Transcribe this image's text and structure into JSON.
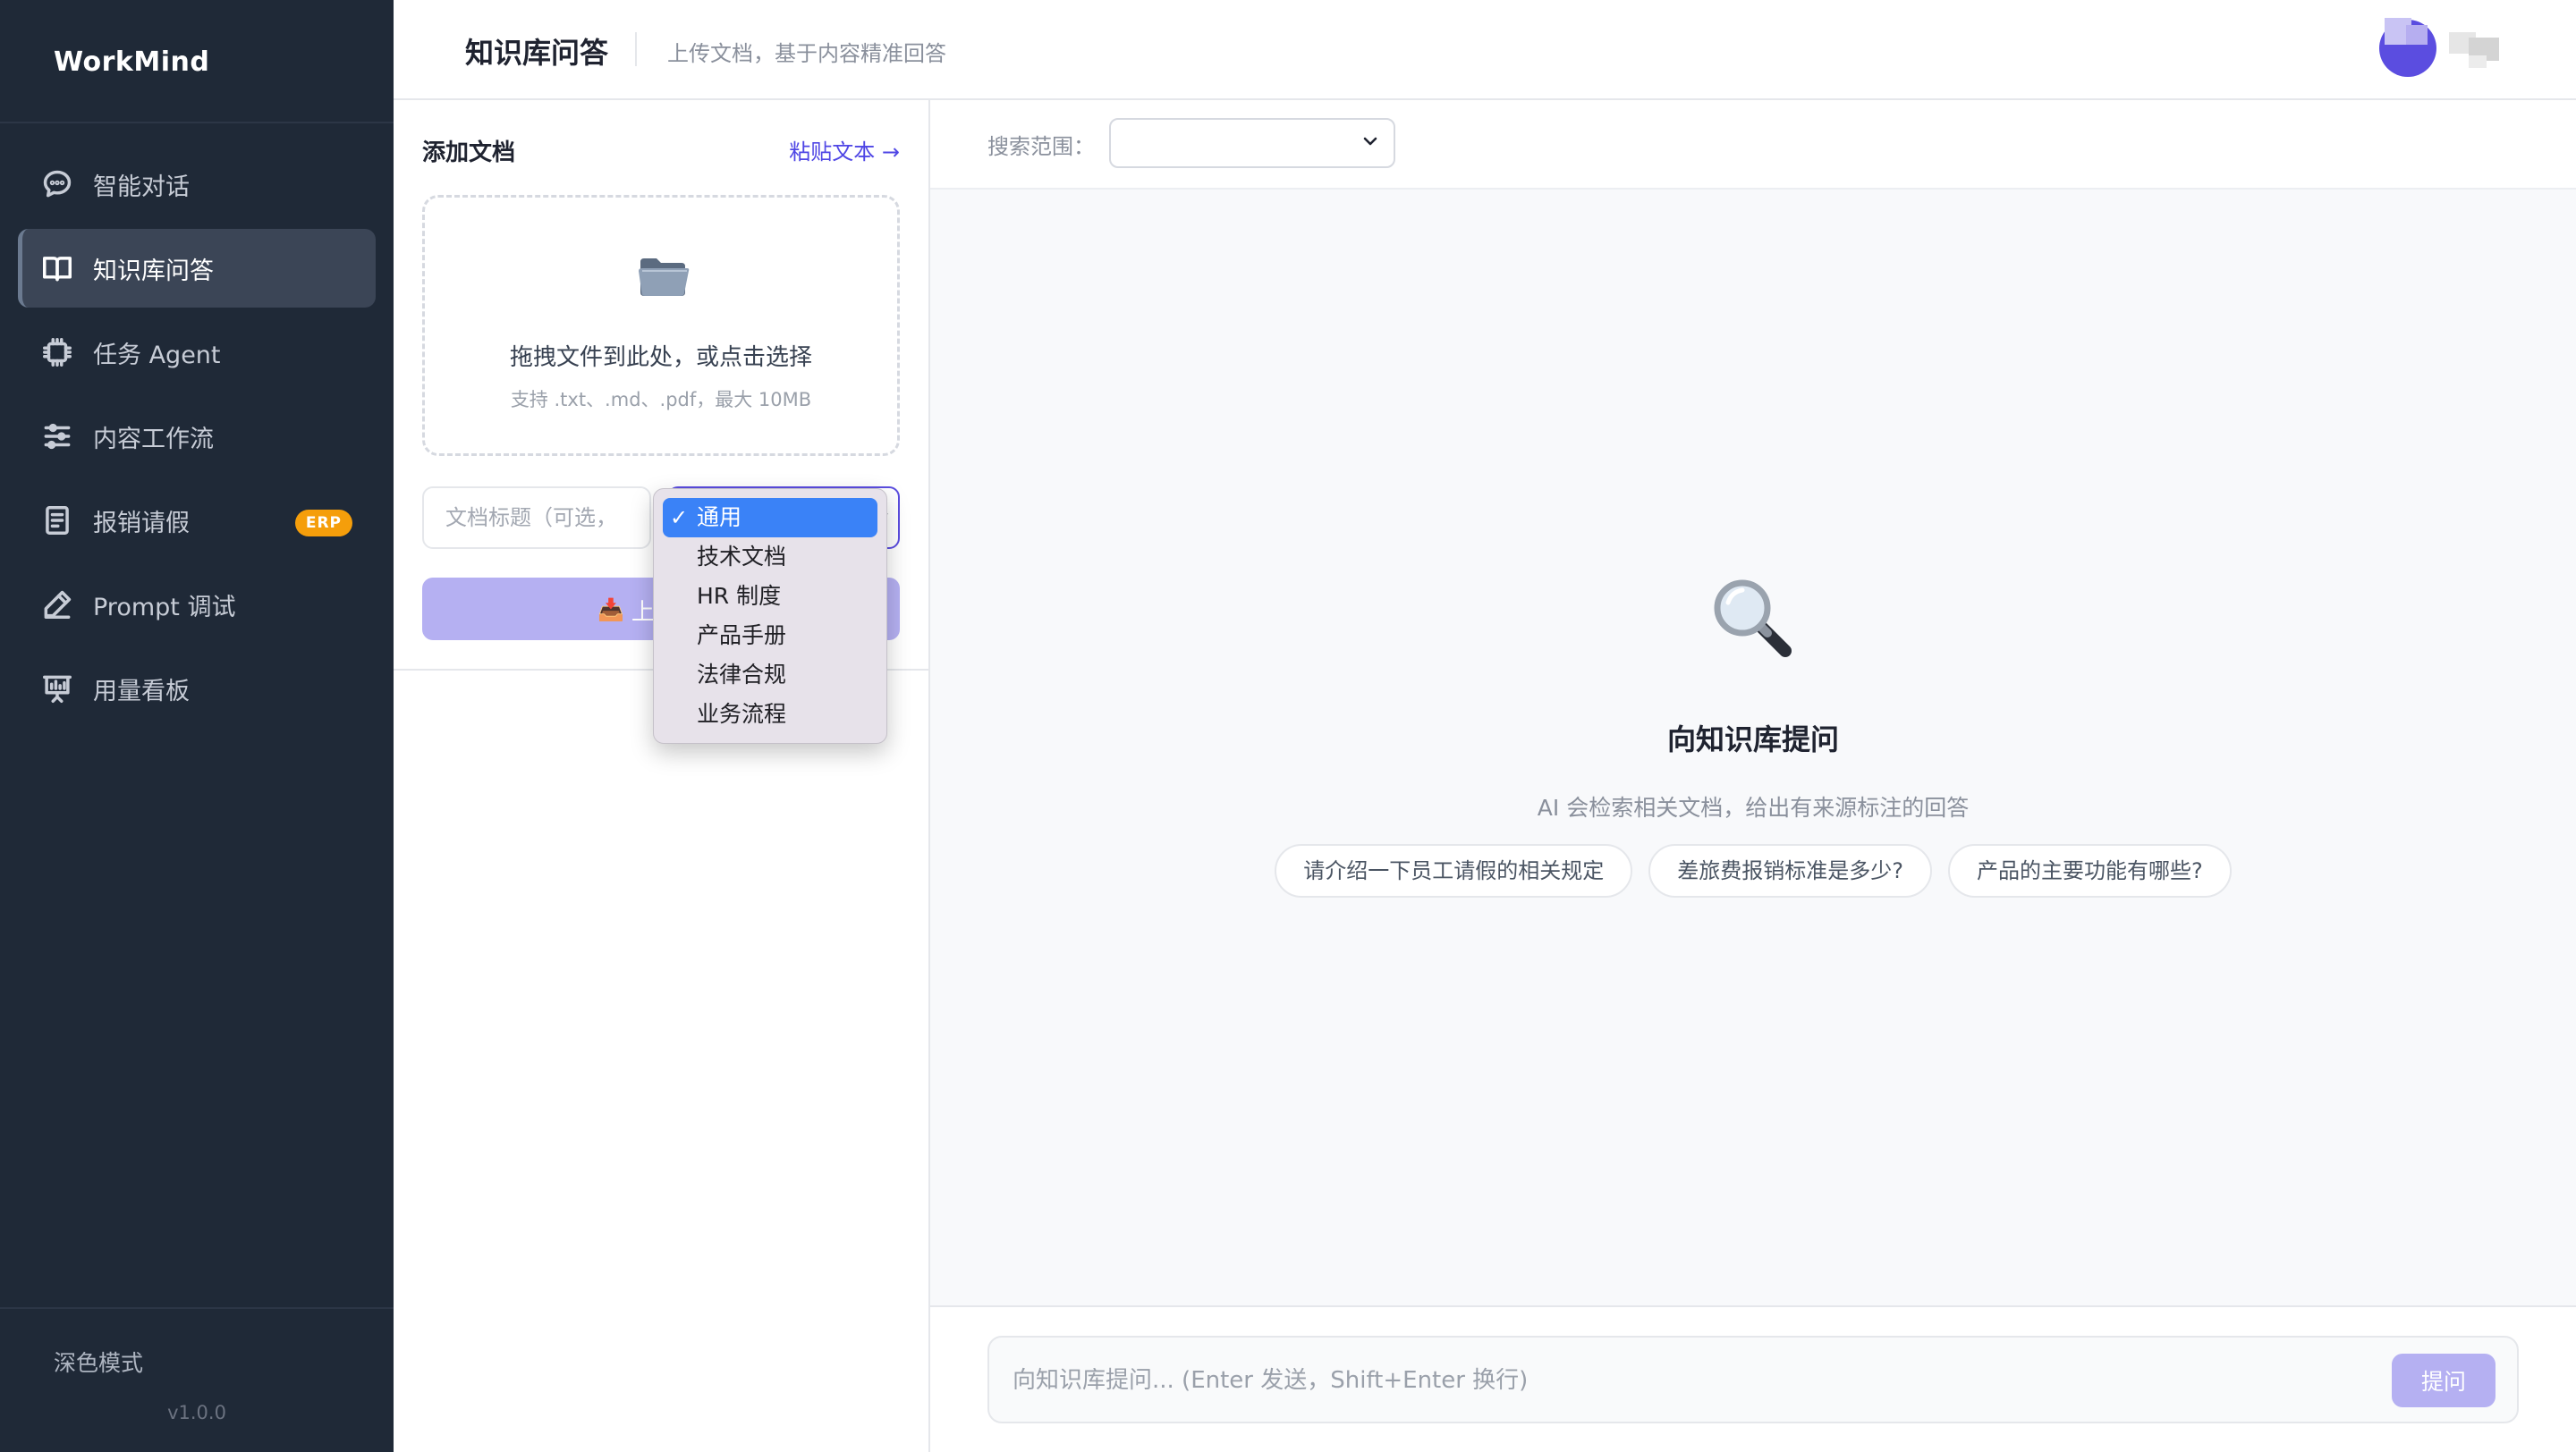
{
  "app": {
    "brand": "WorkMind",
    "version": "v1.0.0",
    "dark_mode_label": "深色模式"
  },
  "sidebar": {
    "items": [
      {
        "label": "智能对话",
        "icon": "chat-bubble-icon",
        "active": false
      },
      {
        "label": "知识库问答",
        "icon": "book-open-icon",
        "active": true
      },
      {
        "label": "任务 Agent",
        "icon": "cpu-chip-icon",
        "active": false
      },
      {
        "label": "内容工作流",
        "icon": "sliders-icon",
        "active": false
      },
      {
        "label": "报销请假",
        "icon": "document-list-icon",
        "active": false,
        "badge": "ERP"
      },
      {
        "label": "Prompt 调试",
        "icon": "pen-icon",
        "active": false
      },
      {
        "label": "用量看板",
        "icon": "presentation-chart-icon",
        "active": false
      }
    ]
  },
  "header": {
    "title": "知识库问答",
    "subtitle": "上传文档，基于内容精准回答"
  },
  "add_doc": {
    "title": "添加文档",
    "paste_link": "粘贴文本 →",
    "dropzone": {
      "icon": "folder-icon",
      "text": "拖拽文件到此处，或点击选择",
      "hint": "支持 .txt、.md、.pdf，最大 10MB"
    },
    "title_input": {
      "placeholder": "文档标题（可选，",
      "value": ""
    },
    "category": {
      "selected": "通用",
      "options": [
        "通用",
        "技术文档",
        "HR 制度",
        "产品手册",
        "法律合规",
        "业务流程"
      ]
    },
    "upload_button": {
      "icon": "inbox-tray-icon",
      "label": "上"
    }
  },
  "main": {
    "scope_label": "搜索范围：",
    "scope_value": "",
    "empty_state": {
      "icon": "magnifier-icon",
      "title": "向知识库提问",
      "description": "AI 会检索相关文档，给出有来源标注的回答"
    },
    "suggestions": [
      "请介绍一下员工请假的相关规定",
      "差旅费报销标准是多少?",
      "产品的主要功能有哪些?"
    ],
    "composer": {
      "placeholder": "向知识库提问... (Enter 发送，Shift+Enter 换行)",
      "submit_label": "提问"
    }
  },
  "colors": {
    "sidebar_bg": "#1f2937",
    "accent": "#4f46e5",
    "accent_light": "#b5b0f2",
    "badge": "#f59e0b",
    "dropdown_selected": "#3a82f7"
  }
}
